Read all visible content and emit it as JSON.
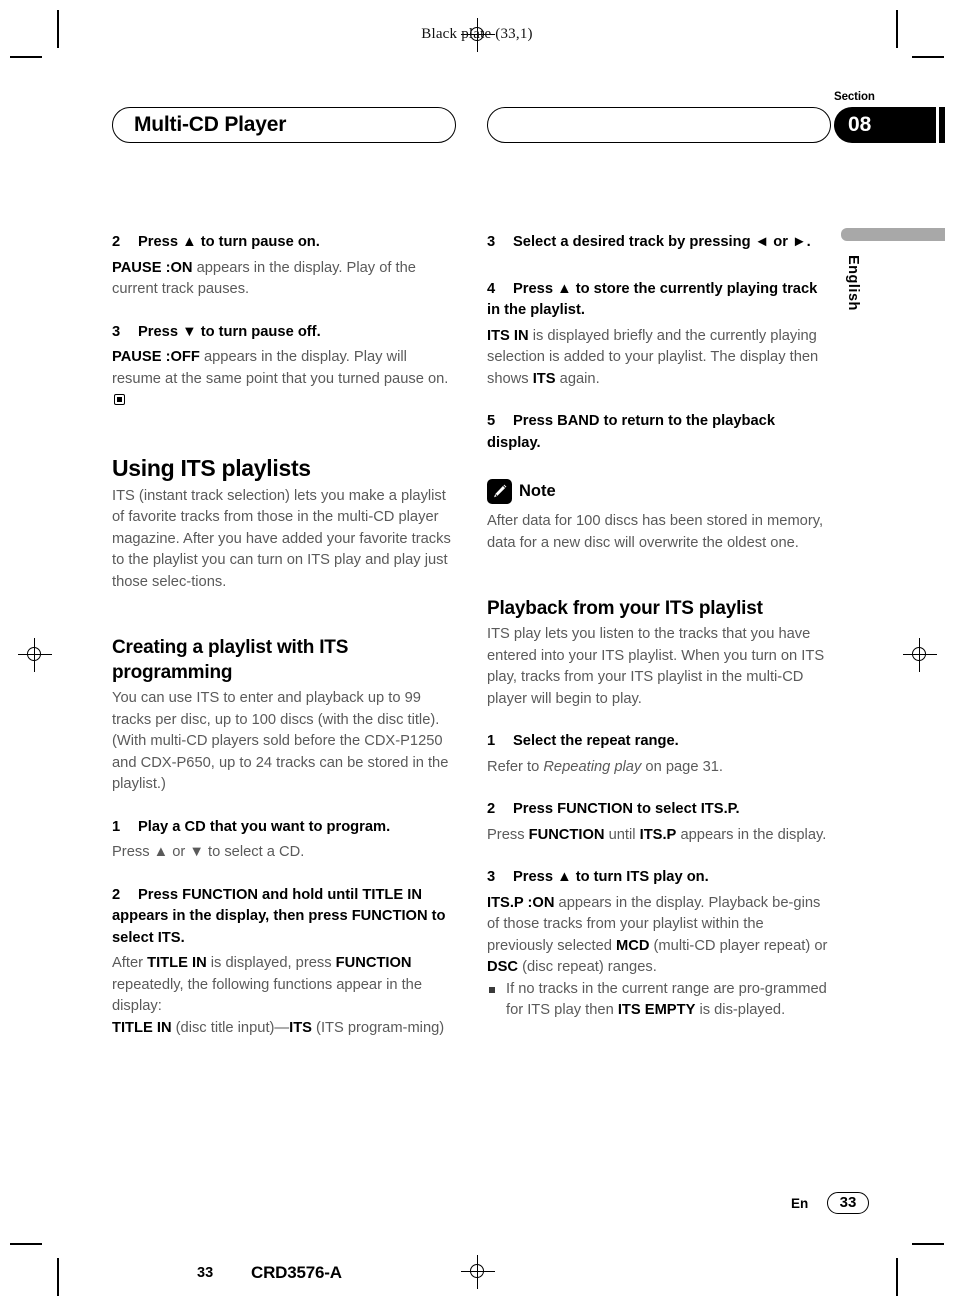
{
  "print_marks": {
    "black_plate": "Black plate (33,1)"
  },
  "header": {
    "title_left": "Multi-CD Player",
    "title_right": "",
    "section_word": "Section",
    "section_number": "08"
  },
  "margin": {
    "language": "English"
  },
  "left_column": [
    {
      "type": "step",
      "number": "2",
      "text": "Press ▲ to turn pause on."
    },
    {
      "type": "para",
      "html": "<b>PAUSE :ON</b> appears in the display. Play of the current track pauses."
    },
    {
      "type": "gap"
    },
    {
      "type": "step",
      "number": "3",
      "text": "Press ▼ to turn pause off."
    },
    {
      "type": "para",
      "html": "<b>PAUSE :OFF</b> appears in the display. Play will resume at the same point that you turned pause on. <span class=\"endmark\"></span>"
    },
    {
      "type": "gap"
    },
    {
      "type": "gap"
    },
    {
      "type": "heading",
      "text": "Using ITS playlists"
    },
    {
      "type": "para",
      "html": "ITS (instant track selection) lets you make a playlist of favorite tracks from those in the multi-CD player magazine. After you have added your favorite tracks to the playlist you can turn on ITS play and play just those selec-tions."
    },
    {
      "type": "gap"
    },
    {
      "type": "gap"
    },
    {
      "type": "subheading",
      "text": "Creating a playlist with ITS programming"
    },
    {
      "type": "para",
      "html": "You can use ITS to enter and playback up to 99 tracks per disc, up to 100 discs (with the disc title). (With multi-CD players sold before the CDX-P1250 and CDX-P650, up to 24 tracks can be stored in the playlist.)"
    },
    {
      "type": "gap"
    },
    {
      "type": "step",
      "number": "1",
      "text": "Play a CD that you want to program."
    },
    {
      "type": "para",
      "html": "Press ▲ or ▼ to select a CD."
    },
    {
      "type": "gap"
    },
    {
      "type": "step",
      "number": "2",
      "text": "Press FUNCTION and hold until TITLE IN appears in the display, then press FUNCTION to select ITS."
    },
    {
      "type": "para",
      "html": "After <b>TITLE IN</b> is displayed, press <b>FUNCTION</b> repeatedly, the following functions appear in the display:"
    },
    {
      "type": "para",
      "html": "<b>TITLE IN</b> (disc title input)—<b>ITS</b> (ITS program-ming)"
    }
  ],
  "right_column": [
    {
      "type": "step",
      "number": "3",
      "text": "Select a desired track by pressing ◄ or ►."
    },
    {
      "type": "gap"
    },
    {
      "type": "step",
      "number": "4",
      "text": "Press ▲ to store the currently playing track in the playlist."
    },
    {
      "type": "para",
      "html": "<b>ITS IN</b> is displayed briefly and the currently playing selection is added to your playlist. The display then shows <b>ITS</b> again."
    },
    {
      "type": "gap"
    },
    {
      "type": "step",
      "number": "5",
      "text": "Press BAND to return to the playback display."
    },
    {
      "type": "gap"
    },
    {
      "type": "note",
      "label": "Note",
      "html": "After data for 100 discs has been stored in memory, data for a new disc will overwrite the oldest one."
    },
    {
      "type": "gap"
    },
    {
      "type": "gap"
    },
    {
      "type": "subheading",
      "text": "Playback from your ITS playlist"
    },
    {
      "type": "para",
      "html": "ITS play lets you listen to the tracks that you have entered into your ITS playlist. When you turn on ITS play, tracks from your ITS playlist in the multi-CD player will begin to play."
    },
    {
      "type": "gap"
    },
    {
      "type": "step",
      "number": "1",
      "text": "Select the repeat range."
    },
    {
      "type": "para",
      "html": "Refer to <i>Repeating play</i> on page 31."
    },
    {
      "type": "gap"
    },
    {
      "type": "step",
      "number": "2",
      "text": "Press FUNCTION to select ITS.P."
    },
    {
      "type": "para",
      "html": "Press <b>FUNCTION</b> until <b>ITS.P</b> appears in the display."
    },
    {
      "type": "gap"
    },
    {
      "type": "step",
      "number": "3",
      "text": "Press ▲ to turn ITS play on."
    },
    {
      "type": "para",
      "html": "<b>ITS.P :ON</b> appears in the display. Playback be-gins of those tracks from your playlist within the previously selected <b>MCD</b> (multi-CD player repeat) or <b>DSC</b> (disc repeat) ranges."
    },
    {
      "type": "bullet",
      "html": "If no tracks in the current range are pro-grammed for ITS play then <b>ITS EMPTY</b> is dis-played."
    }
  ],
  "footer": {
    "language_code": "En",
    "page_number": "33",
    "sheet_number": "33",
    "document_code": "CRD3576-A"
  }
}
